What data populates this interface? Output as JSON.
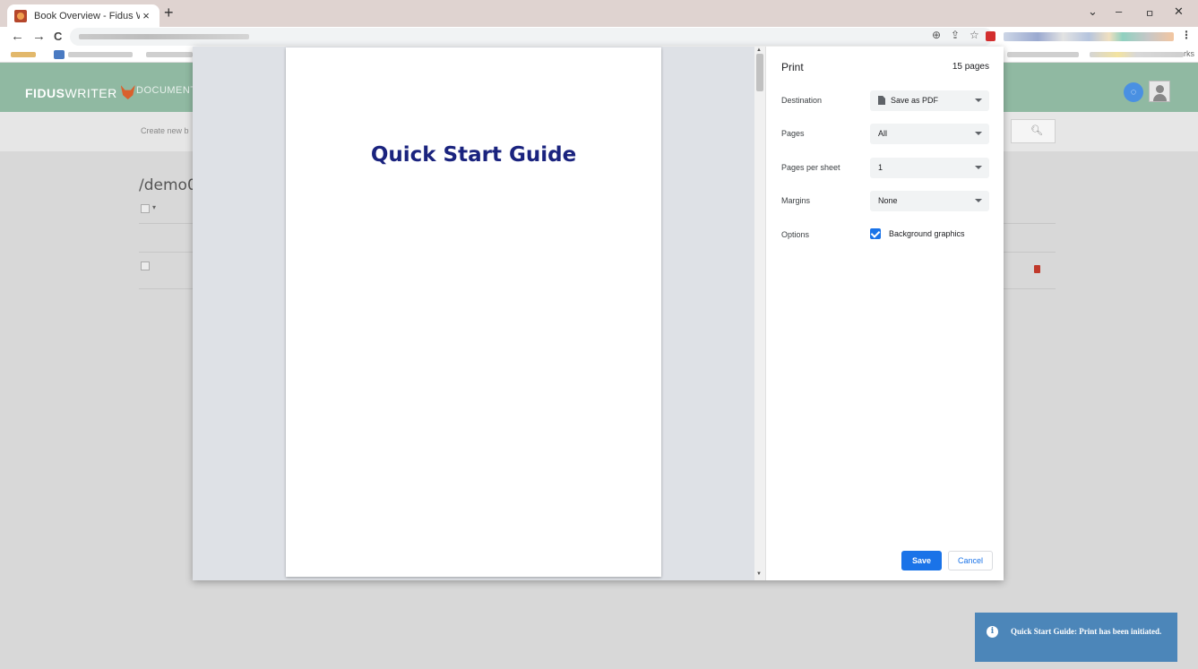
{
  "browser": {
    "tab_title": "Book Overview - Fidus Writer",
    "tab_close": "×",
    "new_tab": "+",
    "nav": {
      "back": "←",
      "forward": "→",
      "reload": "C"
    },
    "window_controls": {
      "chevron": "⌄",
      "minimize": "–",
      "restore": "ㅁ",
      "close": "✕"
    },
    "toolbar_icons": {
      "install": "⊕",
      "share": "⇪",
      "star": "☆",
      "menu": "⋮"
    },
    "bookmarks_tail": "rks"
  },
  "app": {
    "logo_bold": "FIDUS",
    "logo_rest": "WRITER",
    "nav_documents": "DOCUMENT",
    "create_new": "Create new b",
    "folder_title": "/demo0",
    "search_icon": "🔍︎"
  },
  "print": {
    "title": "Print",
    "pages_count": "15 pages",
    "preview_heading": "Quick Start Guide",
    "destination_label": "Destination",
    "destination_value": "Save as PDF",
    "pages_label": "Pages",
    "pages_value": "All",
    "pps_label": "Pages per sheet",
    "pps_value": "1",
    "margins_label": "Margins",
    "margins_value": "None",
    "options_label": "Options",
    "background_graphics_label": "Background graphics",
    "background_graphics_checked": true,
    "save_label": "Save",
    "cancel_label": "Cancel"
  },
  "toast": {
    "icon": "i",
    "message": "Quick Start Guide: Print has been initiated."
  },
  "colors": {
    "header_green": "#90b9a2",
    "primary_blue": "#1a73e8",
    "toast_blue": "#4c86b9",
    "heading_navy": "#1a237e"
  }
}
